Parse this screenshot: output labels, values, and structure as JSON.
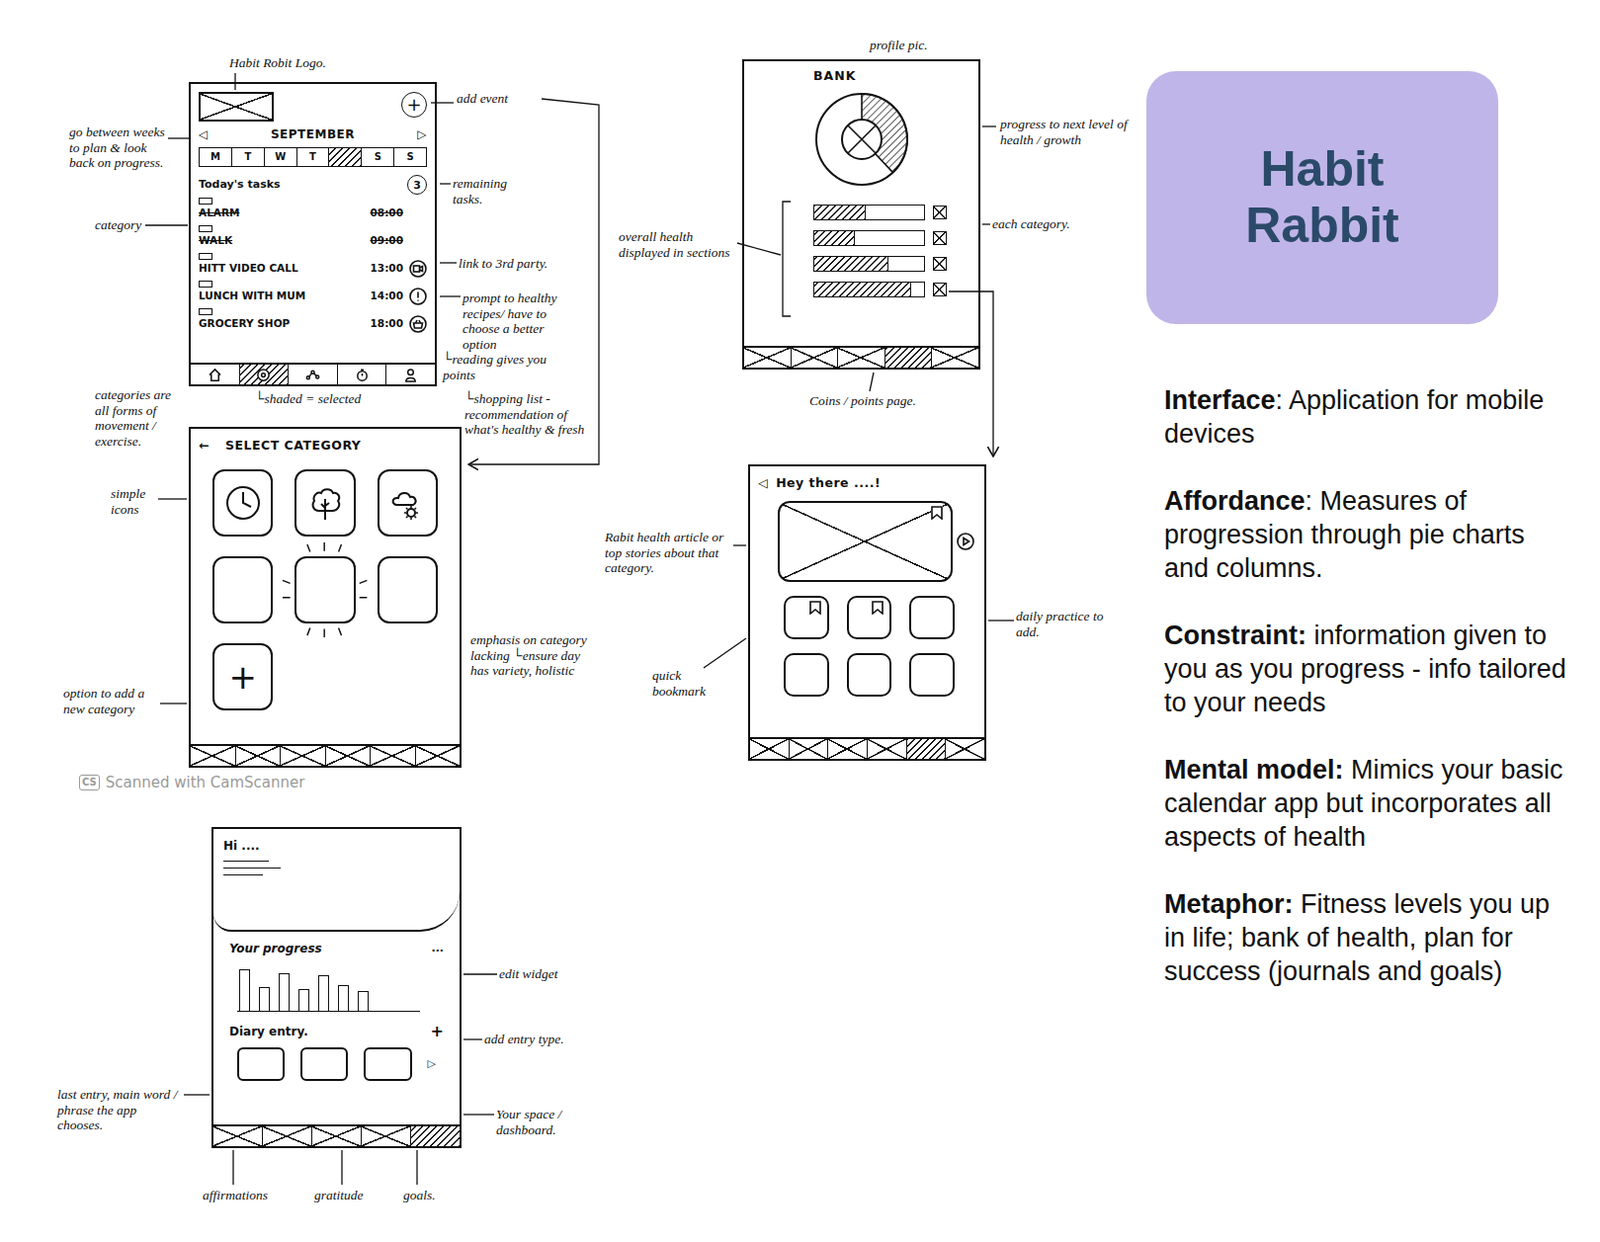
{
  "card": {
    "title": "Habit Rabbit"
  },
  "principles": [
    {
      "term": "Interface",
      "text": ": Application for mobile devices"
    },
    {
      "term": "Affordance",
      "text": ": Measures of progression through pie charts and columns."
    },
    {
      "term": "Constraint:",
      "text": " information given to you as you progress - info tailored to your needs"
    },
    {
      "term": "Mental model:",
      "text": " Mimics your basic calendar app but incorporates all aspects of health"
    },
    {
      "term": "Metaphor:",
      "text": " Fitness levels you up in life; bank of health, plan for success (journals and goals)"
    }
  ],
  "calendar_screen": {
    "add_icon": "+",
    "prev": "◁",
    "month": "SEPTEMBER",
    "next": "▷",
    "days": [
      {
        "label": "M",
        "selected": false
      },
      {
        "label": "T",
        "selected": false
      },
      {
        "label": "W",
        "selected": false
      },
      {
        "label": "T",
        "selected": false
      },
      {
        "selected": true
      },
      {
        "label": "S",
        "selected": false
      },
      {
        "label": "S",
        "selected": false
      }
    ],
    "tasks_title": "Today's tasks",
    "remaining": "3",
    "tasks": [
      {
        "name": "ALARM",
        "time": "08:00",
        "done": true,
        "kind": "plain"
      },
      {
        "name": "WALK",
        "time": "09:00",
        "done": true,
        "kind": "plain"
      },
      {
        "name": "HITT VIDEO CALL",
        "time": "13:00",
        "done": false,
        "kind": "video"
      },
      {
        "name": "LUNCH WITH MUM",
        "time": "14:00",
        "done": false,
        "kind": "recipe"
      },
      {
        "name": "GROCERY SHOP",
        "time": "18:00",
        "done": false,
        "kind": "basket"
      }
    ],
    "nav": [
      {
        "selected": false
      },
      {
        "selected": true
      },
      {
        "selected": false
      },
      {
        "selected": false
      },
      {
        "selected": false
      }
    ],
    "annotations": [
      "Habit Robit Logo.",
      "add event",
      "go between weeks to plan & look back on progress.",
      "remaining tasks.",
      "category",
      "link to 3rd party.",
      "prompt to healthy recipes/ have to choose a better option",
      "└reading gives you points",
      "└shaded = selected",
      "└shopping list - recommendation of what's healthy & fresh"
    ]
  },
  "category_screen": {
    "back": "←",
    "title": "SELECT CATEGORY",
    "tiles": [
      {
        "kind": "clock",
        "emphasis": false
      },
      {
        "kind": "tree",
        "emphasis": false
      },
      {
        "kind": "weather",
        "emphasis": false
      },
      {
        "kind": "empty",
        "emphasis": false
      },
      {
        "kind": "empty",
        "emphasis": true
      },
      {
        "kind": "empty",
        "emphasis": false
      },
      {
        "kind": "add",
        "label": "+",
        "emphasis": false
      }
    ],
    "nav": [
      {
        "selected": false
      },
      {
        "selected": false
      },
      {
        "selected": false
      },
      {
        "selected": false
      },
      {
        "selected": false
      },
      {
        "selected": false
      }
    ],
    "annotations": [
      "categories are all forms of movement / exercise.",
      "simple icons",
      "emphasis on category lacking └ensure day has variety, holistic",
      "option to add a new category"
    ]
  },
  "bank_screen": {
    "title": "BANK",
    "progress": {
      "level": 0.38
    },
    "bars": [
      {
        "level": 0.47
      },
      {
        "level": 0.37
      },
      {
        "level": 0.68
      },
      {
        "level": 0.88
      }
    ],
    "nav": [
      {
        "selected": false
      },
      {
        "selected": false
      },
      {
        "selected": false
      },
      {
        "selected": true
      },
      {
        "selected": false
      }
    ],
    "annotations": [
      "profile pic.",
      "progress to next level of health / growth",
      "overall health displayed in sections",
      "each category.",
      "Coins / points page."
    ]
  },
  "hey_screen": {
    "back": "◁",
    "greeting": "Hey there ....!",
    "article": {
      "bookmarked": true
    },
    "tiles": [
      {
        "bookmarked": true
      },
      {
        "bookmarked": true
      },
      {
        "bookmarked": false
      },
      {
        "bookmarked": false
      },
      {
        "bookmarked": false
      },
      {
        "bookmarked": false
      }
    ],
    "nav": [
      {
        "selected": false
      },
      {
        "selected": false
      },
      {
        "selected": false
      },
      {
        "selected": false
      },
      {
        "selected": true
      },
      {
        "selected": false
      }
    ],
    "annotations": [
      "Rabit health article or top stories about that category.",
      "quick bookmark",
      "daily practice to add."
    ]
  },
  "dashboard_screen": {
    "greeting": "Hi ....",
    "progress_title": "Your progress",
    "more": "...",
    "chart": {
      "values": [
        42,
        24,
        38,
        22,
        36,
        26,
        20
      ]
    },
    "diary_title": "Diary entry.",
    "add_icon": "+",
    "next": "▷",
    "entries": [
      {},
      {},
      {}
    ],
    "nav": [
      {
        "selected": false
      },
      {
        "selected": false
      },
      {
        "selected": false
      },
      {
        "selected": false
      },
      {
        "selected": true
      }
    ],
    "annotations": [
      "edit widget",
      "add entry type.",
      "last entry, main word / phrase the app chooses.",
      "affirmations",
      "gratitude",
      "goals.",
      "Your space / dashboard."
    ]
  },
  "watermark": {
    "badge": "CS",
    "text": "Scanned with CamScanner"
  }
}
